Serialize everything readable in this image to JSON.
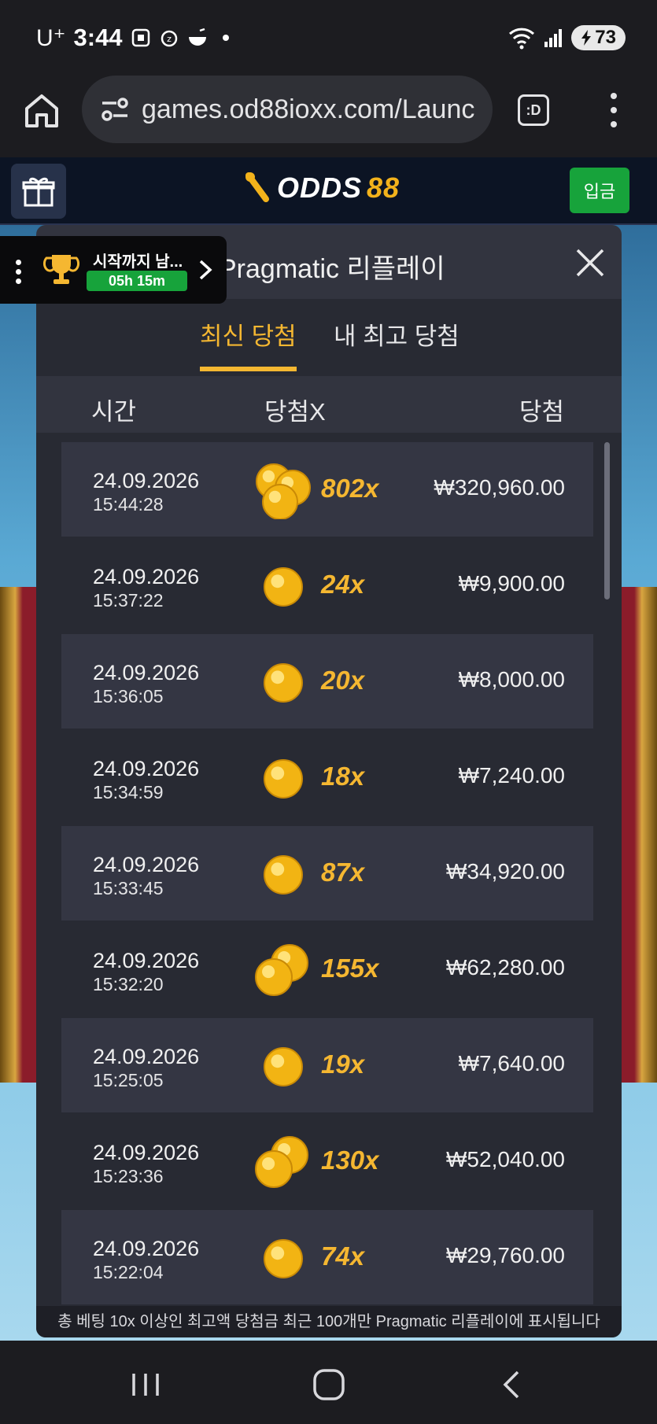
{
  "status": {
    "carrier": "U⁺",
    "time": "3:44",
    "battery": "73"
  },
  "browser": {
    "url": "games.od88ioxx.com/Launc",
    "tab_label": ":D"
  },
  "header": {
    "logo_white": "ODDS",
    "logo_gold": "88",
    "deposit_label": "입금"
  },
  "tournament": {
    "label": "시작까지 남...",
    "timer": "05h 15m"
  },
  "modal": {
    "title": "Pragmatic 리플레이",
    "tabs": [
      {
        "label": "최신 당첨",
        "active": true
      },
      {
        "label": "내 최고 당첨",
        "active": false
      }
    ],
    "columns": {
      "time": "시간",
      "multiplier": "당첨X",
      "win": "당첨"
    },
    "rows": [
      {
        "date": "24.09.2026",
        "time": "15:44:28",
        "coins": 3,
        "multiplier": "802x",
        "amount": "₩320,960.00"
      },
      {
        "date": "24.09.2026",
        "time": "15:37:22",
        "coins": 1,
        "multiplier": "24x",
        "amount": "₩9,900.00"
      },
      {
        "date": "24.09.2026",
        "time": "15:36:05",
        "coins": 1,
        "multiplier": "20x",
        "amount": "₩8,000.00"
      },
      {
        "date": "24.09.2026",
        "time": "15:34:59",
        "coins": 1,
        "multiplier": "18x",
        "amount": "₩7,240.00"
      },
      {
        "date": "24.09.2026",
        "time": "15:33:45",
        "coins": 1,
        "multiplier": "87x",
        "amount": "₩34,920.00"
      },
      {
        "date": "24.09.2026",
        "time": "15:32:20",
        "coins": 2,
        "multiplier": "155x",
        "amount": "₩62,280.00"
      },
      {
        "date": "24.09.2026",
        "time": "15:25:05",
        "coins": 1,
        "multiplier": "19x",
        "amount": "₩7,640.00"
      },
      {
        "date": "24.09.2026",
        "time": "15:23:36",
        "coins": 2,
        "multiplier": "130x",
        "amount": "₩52,040.00"
      },
      {
        "date": "24.09.2026",
        "time": "15:22:04",
        "coins": 1,
        "multiplier": "74x",
        "amount": "₩29,760.00"
      }
    ],
    "footer_note": "총 베팅 10x 이상인 최고액 당첨금 최근 100개만 Pragmatic 리플레이에 표시됩니다"
  },
  "icons": {
    "home": "home-icon",
    "tune": "site-settings-icon",
    "kebab": "more-vert-icon",
    "gift": "gift-icon",
    "trophy": "trophy-icon",
    "close": "close-icon",
    "coin": "gold-coin-icon",
    "recents": "recents-icon",
    "home_nav": "home-nav-icon",
    "back": "back-icon"
  },
  "colors": {
    "accent_gold": "#f5b731",
    "deposit_green": "#17a33b",
    "modal_bg": "#32343f",
    "row_alt": "#343643"
  }
}
